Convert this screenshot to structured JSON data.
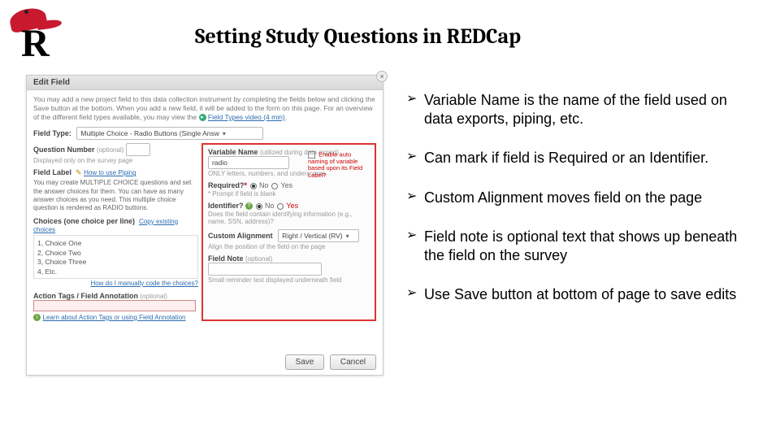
{
  "title": "Setting Study Questions in REDCap",
  "logo_letter": "R",
  "panel": {
    "header": "Edit Field",
    "close": "×",
    "intro_1": "You may add a new project field to this data collection instrument by completing the fields below and clicking the Save button at the bottom. When you add a new field, it will be added to the form on this page. For an overview of the different field types available, you may view the ",
    "video_link": "Field Types video (4 min)",
    "field_type_label": "Field Type:",
    "field_type_value": "Multiple Choice - Radio Buttons (Single Answ",
    "qnum_label": "Question Number",
    "qnum_optional": "(optional)",
    "qnum_note": "Displayed only on the survey page",
    "field_label_hdr": "Field Label",
    "piping_link": "How to use Piping",
    "field_label_text": "You may create MULTIPLE CHOICE questions and set the answer choices for them. You can have as many answer choices as you need. This multiple choice question is rendered as RADIO buttons.",
    "choices_label": "Choices (one choice per line)",
    "copy_choices": "Copy existing choices",
    "choices": [
      "1, Choice One",
      "2, Choice Two",
      "3, Choice Three",
      "4, Etc."
    ],
    "manual_code_link": "How do I manually code the choices?",
    "variable_name_label": "Variable Name",
    "variable_name_hint": "(utilized during data export)",
    "variable_name_value": "radio",
    "variable_name_rule": "ONLY letters, numbers, and underscores",
    "auto_naming": "Enable auto naming of variable based upon its Field Label?",
    "required_label": "Required?",
    "no": "No",
    "yes": "Yes",
    "required_note": "* Prompt if field is blank",
    "identifier_label": "Identifier?",
    "identifier_note": "Does the field contain identifying information (e.g., name, SSN, address)?",
    "custom_align_label": "Custom Alignment",
    "custom_align_value": "Right / Vertical (RV)",
    "custom_align_note": "Align the position of the field on the page",
    "field_note_label": "Field Note",
    "field_note_optional": "(optional)",
    "field_note_hint": "Small reminder text displayed underneath field",
    "action_tags_label": "Action Tags / Field Annotation",
    "action_tags_optional": "(optional)",
    "action_tags_link": "Learn about Action Tags or using Field Annotation",
    "save": "Save",
    "cancel": "Cancel",
    "pencil": "✎",
    "question": "?",
    "info": "i",
    "play": "▸"
  },
  "bullets": [
    "Variable Name is the name of the field used on data exports, piping, etc.",
    "Can mark if field is Required or an Identifier.",
    "Custom Alignment moves field on the page",
    "Field note is optional text that shows up beneath the field on the survey",
    "Use Save button at bottom of page to save edits"
  ]
}
